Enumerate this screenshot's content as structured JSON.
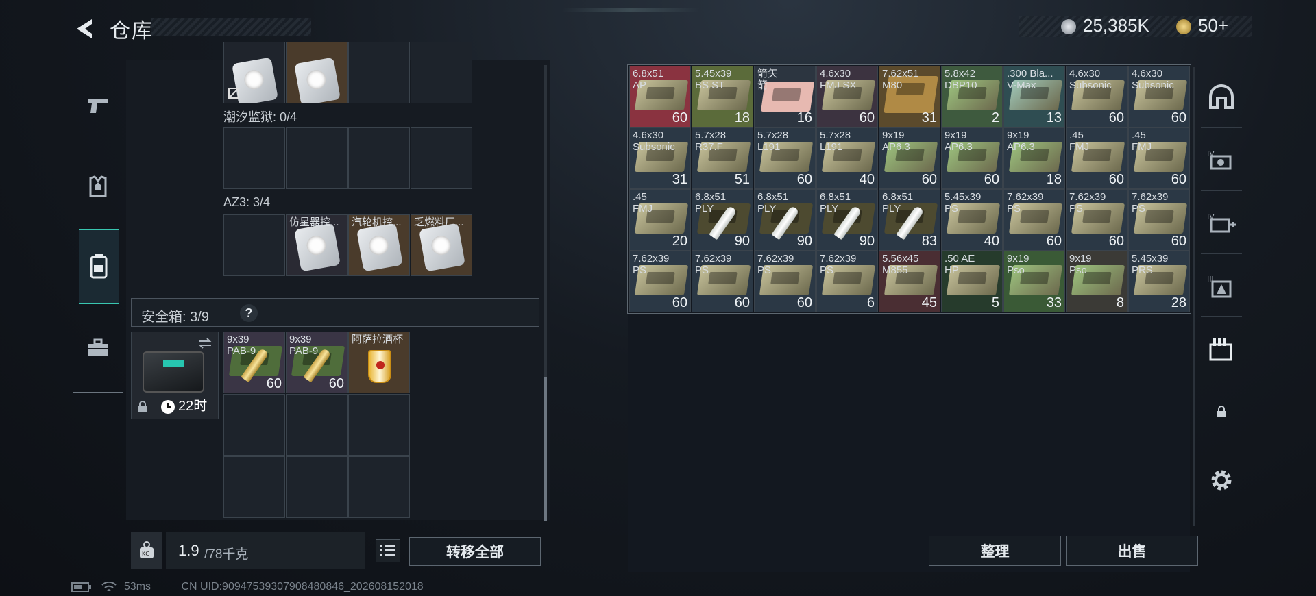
{
  "header": {
    "title": "仓库"
  },
  "currency": {
    "silver": "25,385K",
    "gold": "50+"
  },
  "containers": [
    {
      "label": "潮汐监狱: 0/4",
      "items": [
        "",
        "",
        "",
        ""
      ]
    },
    {
      "label": "AZ3: 3/4",
      "items": [
        "",
        "仿星器控...",
        "汽轮机控...",
        "乏燃料厂..."
      ]
    }
  ],
  "safebox": {
    "label": "安全箱: 3/9",
    "help": "?",
    "timer": "22时",
    "items": [
      {
        "name": "9x39\nPAB-9",
        "count": "60"
      },
      {
        "name": "9x39\nPAB-9",
        "count": "60"
      },
      {
        "name": "阿萨拉酒杯",
        "count": ""
      }
    ]
  },
  "weight": {
    "value": "1.9",
    "max": "/78千克"
  },
  "buttons": {
    "transfer_all": "转移全部",
    "sort": "整理",
    "sell": "出售"
  },
  "stash": [
    {
      "name": "6.8x51\nAP",
      "count": "60",
      "color": "#8a3340"
    },
    {
      "name": "5.45x39\nBS ST",
      "count": "18",
      "color": "#5b6b3a"
    },
    {
      "name": "箭矢\n箭",
      "count": "16",
      "color": "#2c3540"
    },
    {
      "name": "4.6x30\nFMJ SX",
      "count": "60",
      "color": "#3c3340"
    },
    {
      "name": "7.62x51\nM80",
      "count": "31",
      "color": "#5b4a2c"
    },
    {
      "name": "5.8x42\nDBP10",
      "count": "2",
      "color": "#3e5a3e"
    },
    {
      "name": ".300 Bla...\nV-Max",
      "count": "13",
      "color": "#2f4d52"
    },
    {
      "name": "4.6x30\nSubsonic",
      "count": "60",
      "color": "#2b3845"
    },
    {
      "name": "4.6x30\nSubsonic",
      "count": "60",
      "color": "#2b3845"
    },
    {
      "name": "4.6x30\nSubsonic",
      "count": "31",
      "color": "#2b3845"
    },
    {
      "name": "5.7x28\nR37.F",
      "count": "51",
      "color": "#2b3845"
    },
    {
      "name": "5.7x28\nL191",
      "count": "60",
      "color": "#2b3845"
    },
    {
      "name": "5.7x28\nL191",
      "count": "40",
      "color": "#2b3845"
    },
    {
      "name": "9x19\nAP6.3",
      "count": "60",
      "color": "#2b3845"
    },
    {
      "name": "9x19\nAP6.3",
      "count": "60",
      "color": "#2b3845"
    },
    {
      "name": "9x19\nAP6.3",
      "count": "18",
      "color": "#2b3845"
    },
    {
      "name": ".45\nFMJ",
      "count": "60",
      "color": "#2b3845"
    },
    {
      "name": ".45\nFMJ",
      "count": "60",
      "color": "#2b3845"
    },
    {
      "name": ".45\nFMJ",
      "count": "20",
      "color": "#2b3845"
    },
    {
      "name": "6.8x51\nPLY",
      "count": "90",
      "color": "#2b3845"
    },
    {
      "name": "6.8x51\nPLY",
      "count": "90",
      "color": "#2b3845"
    },
    {
      "name": "6.8x51\nPLY",
      "count": "90",
      "color": "#2b3845"
    },
    {
      "name": "6.8x51\nPLY",
      "count": "83",
      "color": "#2b3845"
    },
    {
      "name": "5.45x39\nPS",
      "count": "40",
      "color": "#2b3845"
    },
    {
      "name": "7.62x39\nPS",
      "count": "60",
      "color": "#2b3845"
    },
    {
      "name": "7.62x39\nPS",
      "count": "60",
      "color": "#2b3845"
    },
    {
      "name": "7.62x39\nPS",
      "count": "60",
      "color": "#2b3845"
    },
    {
      "name": "7.62x39\nPS",
      "count": "60",
      "color": "#2b3845"
    },
    {
      "name": "7.62x39\nPS",
      "count": "60",
      "color": "#2b3845"
    },
    {
      "name": "7.62x39\nPS",
      "count": "60",
      "color": "#2b3845"
    },
    {
      "name": "7.62x39\nPS",
      "count": "6",
      "color": "#2b3845"
    },
    {
      "name": "5.56x45\nM855",
      "count": "45",
      "color": "#4a2e33"
    },
    {
      "name": ".50 AE\nHP",
      "count": "5",
      "color": "#263b2c"
    },
    {
      "name": "9x19\nPso",
      "count": "33",
      "color": "#3a5a36"
    },
    {
      "name": "9x19\nPso",
      "count": "8",
      "color": "#3b3a36"
    },
    {
      "name": "5.45x39\nPRS",
      "count": "28",
      "color": "#2b3845"
    }
  ],
  "footer": {
    "ping": "53ms",
    "uid": "CN UID:909475393079084808​46_202608152018"
  }
}
